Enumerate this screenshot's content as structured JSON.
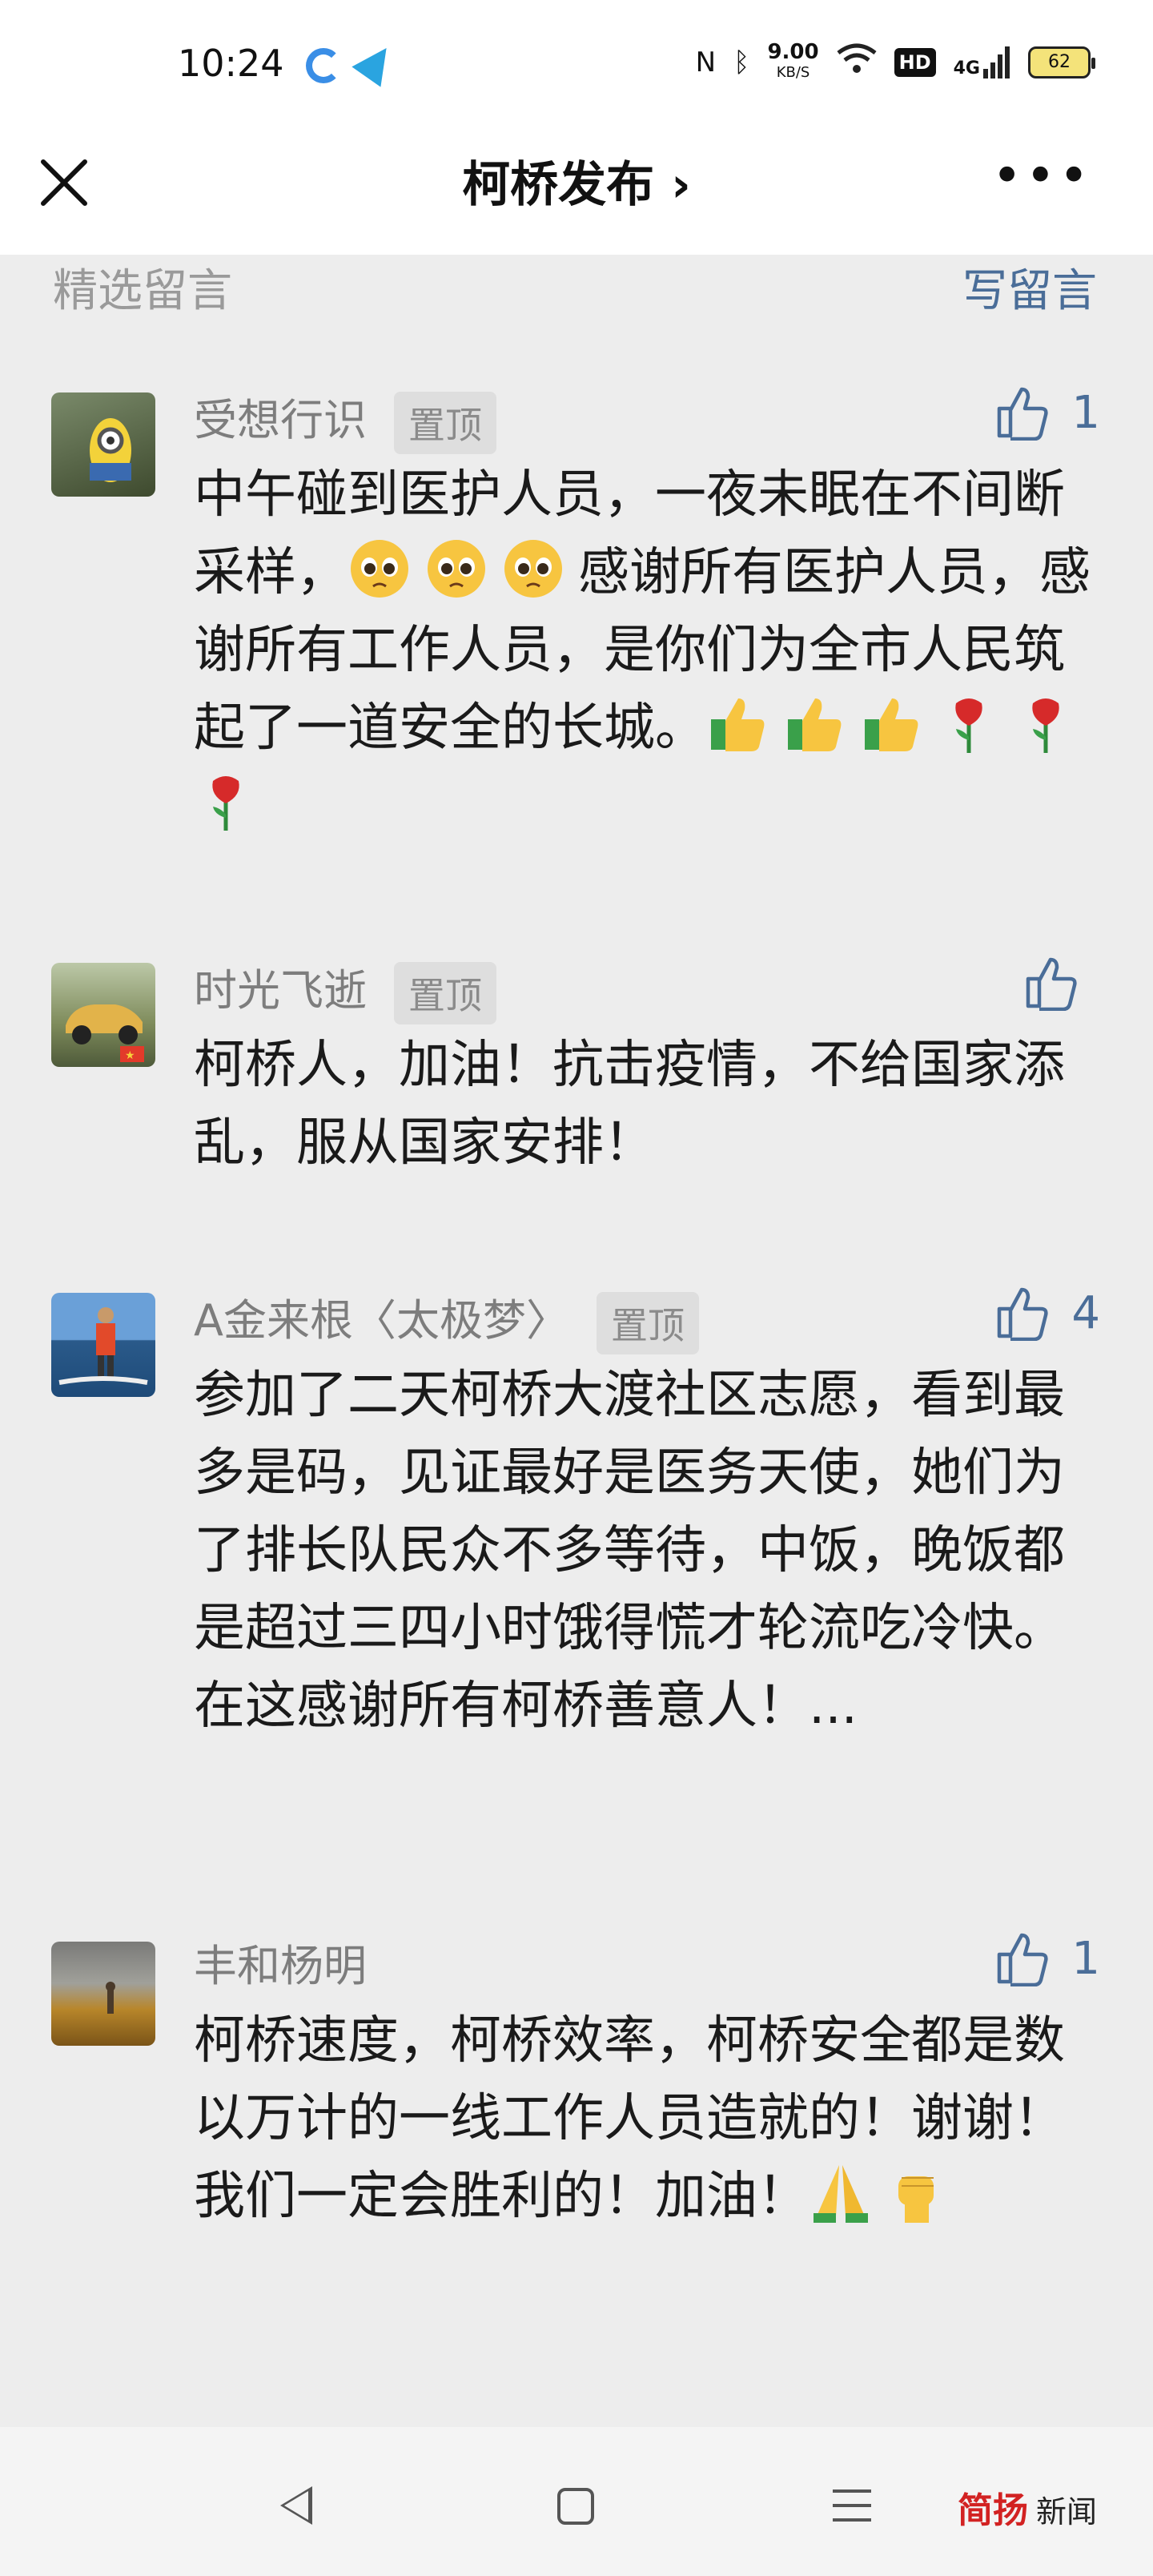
{
  "status": {
    "time": "10:24",
    "speed_value": "9.00",
    "speed_unit": "KB/S",
    "hd": "HD",
    "network": "4G",
    "battery": "62"
  },
  "header": {
    "title": "柯桥发布 ›"
  },
  "section": {
    "title": "精选留言",
    "write": "写留言"
  },
  "comments": [
    {
      "name": "受想行识",
      "pin": "置顶",
      "likes": "1",
      "text": "中午碰到医护人员，一夜未眠在不间断采样，",
      "text2": "感谢所有医护人员，感谢所有工作人员，是你们为全市人民筑起了一道安全的长城。"
    },
    {
      "name": "时光飞逝",
      "pin": "置顶",
      "likes": "",
      "text": "柯桥人，加油！抗击疫情，不给国家添乱，服从国家安排！"
    },
    {
      "name": "A金来根〈太极梦〉",
      "pin": "置顶",
      "likes": "4",
      "text": "参加了二天柯桥大渡社区志愿，看到最多是码，见证最好是医务天使，她们为了排长队民众不多等待，中饭，晚饭都是超过三四小时饿得慌才轮流吃冷快。在这感谢所有柯桥善意人！..."
    },
    {
      "name": "丰和杨明",
      "pin": "",
      "likes": "1",
      "text": "柯桥速度，柯桥效率，柯桥安全都是数以万计的一线工作人员造就的！谢谢！我们一定会胜利的！加油！"
    }
  ],
  "watermark": {
    "brand": "简扬",
    "news": "新闻"
  }
}
